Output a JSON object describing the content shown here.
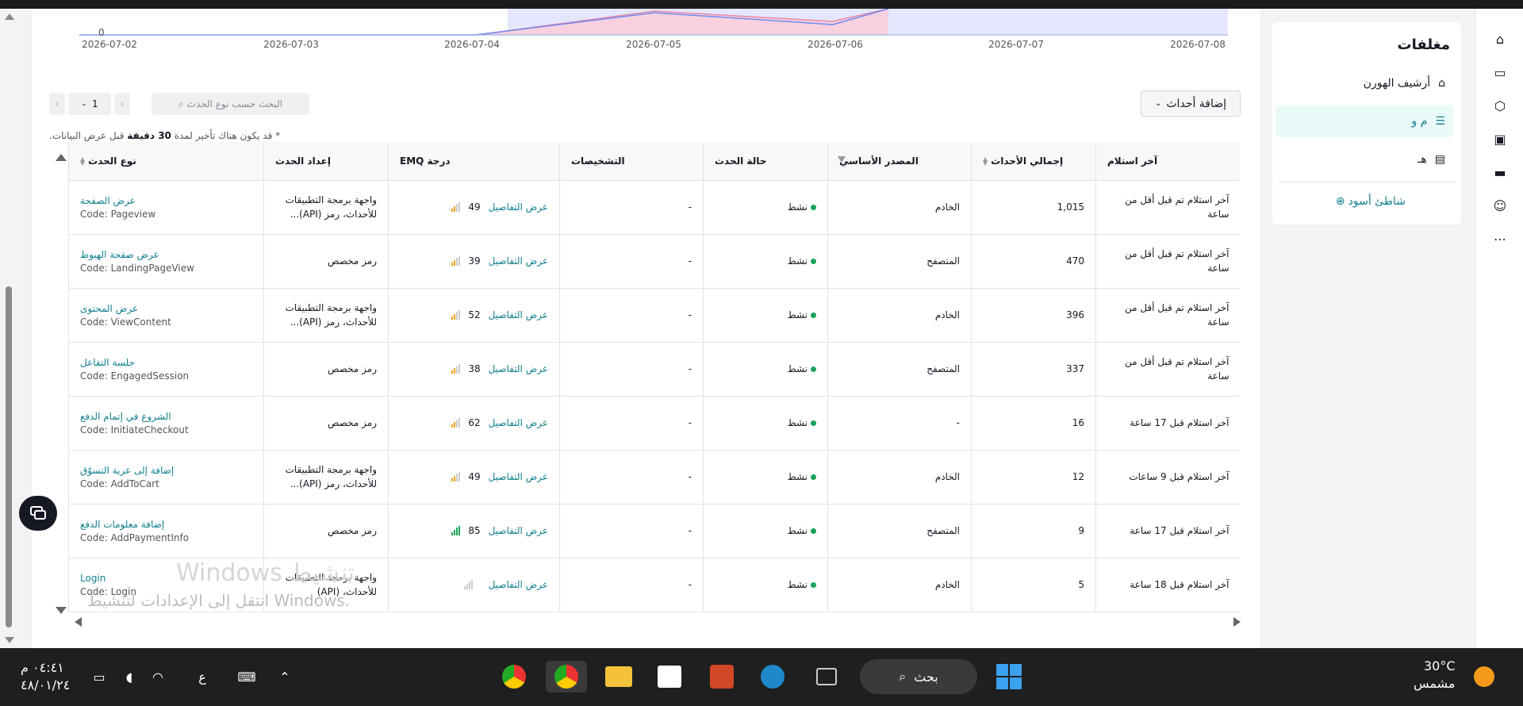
{
  "chart": {
    "y_tick": "0",
    "x_labels": [
      "2026-07-02",
      "2026-07-03",
      "2026-07-04",
      "2026-07-05",
      "2026-07-06",
      "2026-07-07",
      "2026-07-08"
    ]
  },
  "toolbar": {
    "add_events_label": "إضافة أحداث",
    "search_placeholder": "البحث حسب نوع الحدث",
    "page_number": "1"
  },
  "note": {
    "prefix": "* قد يكون هناك تأخير لمدة ",
    "bold": "30 دقيقة",
    "suffix": " قبل عرض البيانات."
  },
  "table": {
    "headers": {
      "last_received": "آخر استلام",
      "total_events": "إجمالي الأحداث",
      "primary_source": "المصدر الأساسي",
      "event_status": "حالة الحدث",
      "diagnostics": "التشخيصات",
      "emq": "EMQ درجة",
      "event_setup": "إعداد الحدث",
      "event_type": "نوع الحدث"
    },
    "view_details_label": "عرض التفاصيل",
    "rows": [
      {
        "last": "آخر استلام تم قبل أقل من ساعة",
        "total": "1,015",
        "source": "الخادم",
        "status": "نشط",
        "diag": "-",
        "emq": "49",
        "setup": "واجهة برمجة التطبيقات للأحداث، رمز (API)...",
        "name": "عرض الصفحة",
        "code": "Code: Pageview"
      },
      {
        "last": "آخر استلام تم قبل أقل من ساعة",
        "total": "470",
        "source": "المتصفح",
        "status": "نشط",
        "diag": "-",
        "emq": "39",
        "setup": "رمز مخصص",
        "name": "عرض صفحة الهبوط",
        "code": "Code: LandingPageView"
      },
      {
        "last": "آخر استلام تم قبل أقل من ساعة",
        "total": "396",
        "source": "الخادم",
        "status": "نشط",
        "diag": "-",
        "emq": "52",
        "setup": "واجهة برمجة التطبيقات للأحداث، رمز (API)...",
        "name": "عرض المحتوى",
        "code": "Code: ViewContent"
      },
      {
        "last": "آخر استلام تم قبل أقل من ساعة",
        "total": "337",
        "source": "المتصفح",
        "status": "نشط",
        "diag": "-",
        "emq": "38",
        "setup": "رمز مخصص",
        "name": "جلسة التفاعل",
        "code": "Code: EngagedSession"
      },
      {
        "last": "آخر استلام قبل 17 ساعة",
        "total": "16",
        "source": "-",
        "status": "نشط",
        "diag": "-",
        "emq": "62",
        "setup": "رمز مخصص",
        "name": "الشروع في إتمام الدفع",
        "code": "Code: InitiateCheckout"
      },
      {
        "last": "آخر استلام قبل 9 ساعات",
        "total": "12",
        "source": "الخادم",
        "status": "نشط",
        "diag": "-",
        "emq": "49",
        "setup": "واجهة برمجة التطبيقات للأحداث، رمز (API)...",
        "name": "إضافة إلى عربة التسوّق",
        "code": "Code: AddToCart"
      },
      {
        "last": "آخر استلام قبل 17 ساعة",
        "total": "9",
        "source": "المتصفح",
        "status": "نشط",
        "diag": "-",
        "emq": "85",
        "setup": "رمز مخصص",
        "name": "إضافة معلومات الدفع",
        "code": "Code: AddPaymentInfo"
      },
      {
        "last": "آخر استلام قبل 18 ساعة",
        "total": "5",
        "source": "الخادم",
        "status": "نشط",
        "diag": "-",
        "emq": "",
        "setup": "واجهة برمجة التطبيقات للأحداث، (API)",
        "name": "Login",
        "code": "Code: Login"
      }
    ]
  },
  "sidebar": {
    "title": "مغلفات",
    "items": [
      {
        "label": "أرشيف الهورن",
        "icon": "home-icon"
      },
      {
        "label": "م و",
        "icon": "list-icon"
      },
      {
        "label": "هـ",
        "icon": "store-icon"
      }
    ],
    "black_link": "شاطئ أسود"
  },
  "watermark": {
    "line1": "Windows تنشيط",
    "line2": "انتقل إلى الإعدادات لتنشيط Windows."
  },
  "taskbar": {
    "search_label": "بحث",
    "time": "٠٤:٤١ م",
    "date": "٤٨/٠١/٢٤",
    "lang": "ع",
    "temp": "30°C",
    "weather": "مشمس"
  },
  "colors": {
    "accent": "#0f7f8f",
    "status_green": "#1ba15a",
    "chart_pink": "#f8c8d8",
    "chart_blue": "#dfe3ff"
  }
}
